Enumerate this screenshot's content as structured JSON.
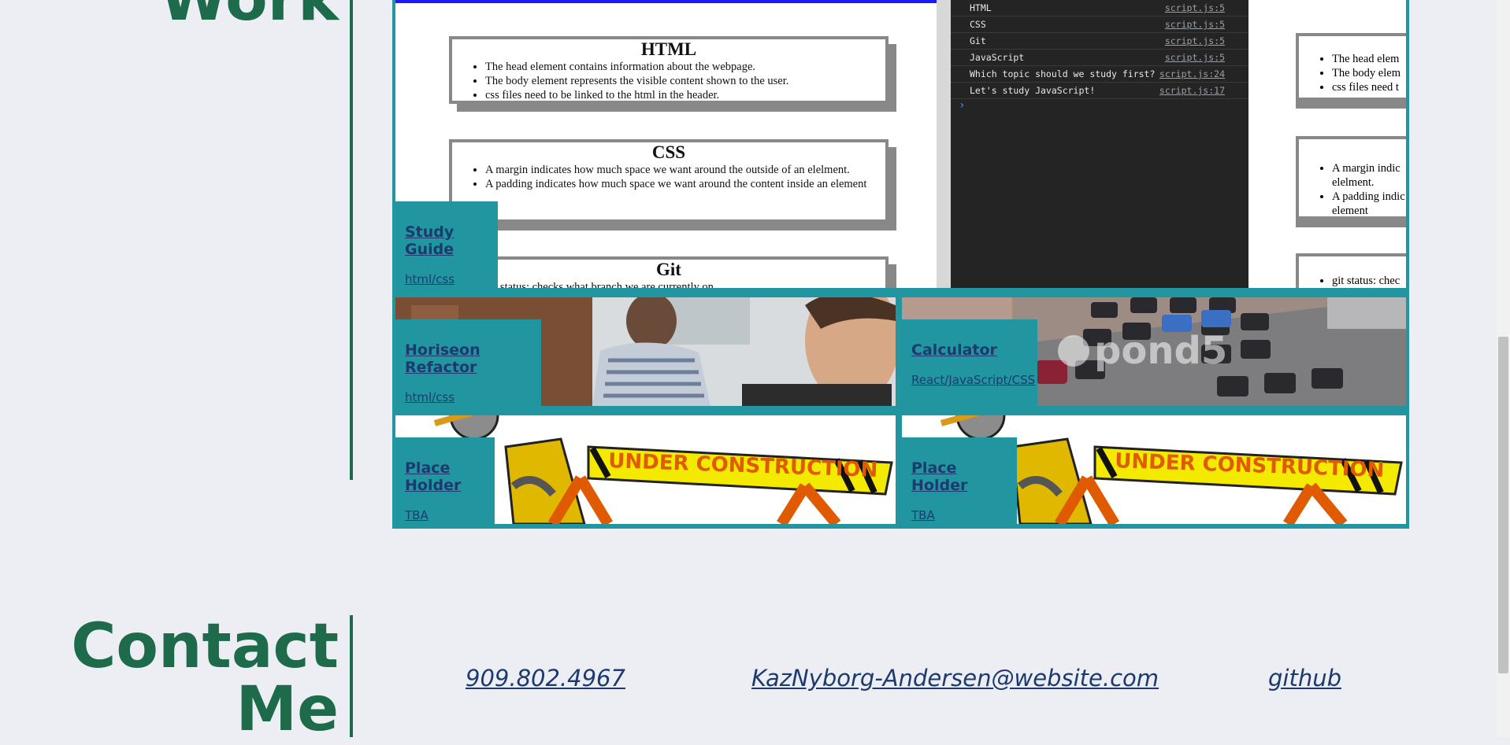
{
  "sections": {
    "work_title": "Work",
    "contact_title_line1": "Contact",
    "contact_title_line2": "Me"
  },
  "projects": [
    {
      "title": "Study Guide",
      "subtitle": "html/css"
    },
    {
      "title": "Horiseon Refactor",
      "subtitle": "html/css"
    },
    {
      "title": "Calculator",
      "subtitle": "React/JavaScript/CSS"
    },
    {
      "title": "Place Holder",
      "subtitle": "TBA"
    },
    {
      "title": "Place Holder",
      "subtitle": "TBA"
    }
  ],
  "study_guide_preview": {
    "cards": [
      {
        "heading": "HTML",
        "items": [
          "The head element contains information about the webpage.",
          "The body element represents the visible content shown to the user.",
          "css files need to be linked to the html in the header."
        ]
      },
      {
        "heading": "CSS",
        "items": [
          "A margin indicates how much space we want around the outside of an elelment.",
          "A padding indicates how much space we want around the content inside an element"
        ]
      },
      {
        "heading": "Git",
        "items": [
          "git status: checks what branch we are currently on"
        ]
      }
    ],
    "console_rows": [
      {
        "text": "HTML",
        "src": "script.js:5"
      },
      {
        "text": "CSS",
        "src": "script.js:5"
      },
      {
        "text": "Git",
        "src": "script.js:5"
      },
      {
        "text": "JavaScript",
        "src": "script.js:5"
      },
      {
        "text": "Which topic should we study first?",
        "src": "script.js:24"
      },
      {
        "text": "Let's study JavaScript!",
        "src": "script.js:17"
      }
    ],
    "console_prompt": "›",
    "right_partial": [
      "The head elem",
      "The body elem",
      "css files need t",
      "A margin indic",
      "elelment.",
      "A padding indic",
      "element",
      "git status: chec"
    ]
  },
  "construction_banner_text": "UNDER CONSTRUCTION",
  "calculator_watermark": "pond5",
  "contact": {
    "phone": "909.802.4967",
    "email": "KazNyborg-Andersen@website.com",
    "github": "github"
  },
  "colors": {
    "accent_green": "#1d6b4b",
    "teal": "#2196a0",
    "link_blue": "#1c3a6e",
    "background": "#eceef4"
  }
}
